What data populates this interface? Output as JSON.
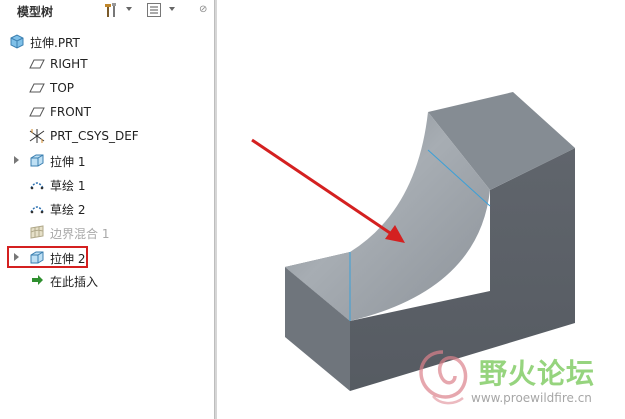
{
  "panel": {
    "title": "模型树"
  },
  "tree": {
    "items": [
      {
        "label": "拉伸.PRT",
        "icon": "part-icon"
      },
      {
        "label": "RIGHT",
        "icon": "datum-plane-icon"
      },
      {
        "label": "TOP",
        "icon": "datum-plane-icon"
      },
      {
        "label": "FRONT",
        "icon": "datum-plane-icon"
      },
      {
        "label": "PRT_CSYS_DEF",
        "icon": "coordinate-system-icon"
      },
      {
        "label": "拉伸 1",
        "icon": "extrude-icon",
        "expandable": true
      },
      {
        "label": "草绘 1",
        "icon": "sketch-icon"
      },
      {
        "label": "草绘 2",
        "icon": "sketch-icon"
      },
      {
        "label": "边界混合 1",
        "icon": "boundary-blend-icon",
        "state": "suppressed"
      },
      {
        "label": "拉伸 2",
        "icon": "extrude-icon",
        "expandable": true,
        "highlighted": true
      },
      {
        "label": "在此插入",
        "icon": "insert-here-icon"
      }
    ]
  },
  "watermark": {
    "text": "野火论坛",
    "url": "www.proewildfire.cn"
  },
  "colors": {
    "highlight": "#d42020",
    "arrow": "#d42020",
    "model_top": "#8a9198",
    "model_side": "#5c6168",
    "model_surface": "#9aa1a8",
    "edge": "#3aa0d8"
  }
}
